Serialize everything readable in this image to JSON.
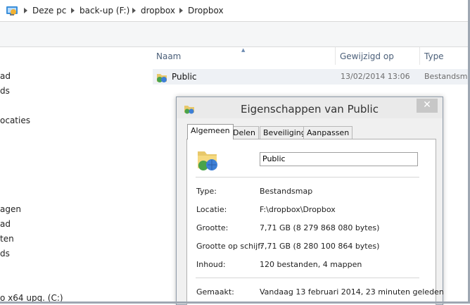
{
  "addressbar": {
    "crumbs": [
      "Deze pc",
      "back-up (F:)",
      "dropbox",
      "Dropbox"
    ]
  },
  "navpane": {
    "items": [
      "ad",
      "ds",
      "ocaties",
      "agen",
      "ad",
      "ten",
      "ds",
      "o x64 upg. (C:)"
    ]
  },
  "filelist": {
    "columns": {
      "name": "Naam",
      "modified": "Gewijzigd op",
      "type": "Type"
    },
    "rows": [
      {
        "name": "Public",
        "modified": "13/02/2014 13:06",
        "type": "Bestandsmap",
        "icon": "dropbox-shared-folder-icon"
      }
    ]
  },
  "dialog": {
    "title": "Eigenschappen van Public",
    "close_label": "✕",
    "tabs": [
      "Algemeen",
      "Delen",
      "Beveiliging",
      "Aanpassen"
    ],
    "active_tab": "Algemeen",
    "name_value": "Public",
    "properties": [
      {
        "label": "Type:",
        "value": "Bestandsmap"
      },
      {
        "label": "Locatie:",
        "value": "F:\\dropbox\\Dropbox"
      },
      {
        "label": "Grootte:",
        "value": "7,71 GB (8 279 868 080 bytes)"
      },
      {
        "label": "Grootte op schijf:",
        "value": "7,71 GB (8 280 100 864 bytes)"
      },
      {
        "label": "Inhoud:",
        "value": "120 bestanden, 4 mappen"
      },
      {
        "label": "Gemaakt:",
        "value": "Vandaag 13 februari 2014, 23 minuten geleden"
      }
    ]
  },
  "colors": {
    "accent": "#4c607a",
    "selected_row": "#eef1f5",
    "dialog_bg": "#f0f0f0"
  }
}
